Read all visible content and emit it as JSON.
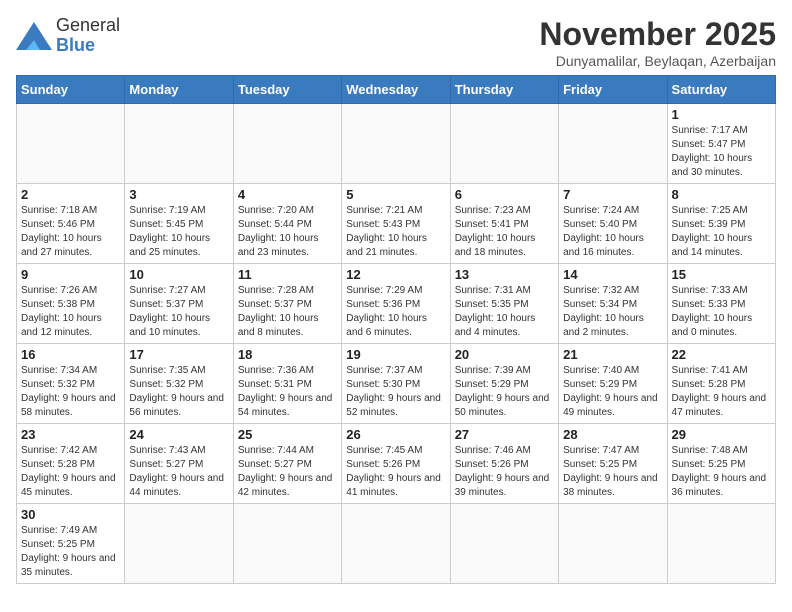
{
  "header": {
    "logo_line1": "General",
    "logo_line2": "Blue",
    "month_title": "November 2025",
    "location": "Dunyamalilar, Beylaqan, Azerbaijan"
  },
  "days_of_week": [
    "Sunday",
    "Monday",
    "Tuesday",
    "Wednesday",
    "Thursday",
    "Friday",
    "Saturday"
  ],
  "weeks": [
    [
      {
        "day": "",
        "info": ""
      },
      {
        "day": "",
        "info": ""
      },
      {
        "day": "",
        "info": ""
      },
      {
        "day": "",
        "info": ""
      },
      {
        "day": "",
        "info": ""
      },
      {
        "day": "",
        "info": ""
      },
      {
        "day": "1",
        "info": "Sunrise: 7:17 AM\nSunset: 5:47 PM\nDaylight: 10 hours and 30 minutes."
      }
    ],
    [
      {
        "day": "2",
        "info": "Sunrise: 7:18 AM\nSunset: 5:46 PM\nDaylight: 10 hours and 27 minutes."
      },
      {
        "day": "3",
        "info": "Sunrise: 7:19 AM\nSunset: 5:45 PM\nDaylight: 10 hours and 25 minutes."
      },
      {
        "day": "4",
        "info": "Sunrise: 7:20 AM\nSunset: 5:44 PM\nDaylight: 10 hours and 23 minutes."
      },
      {
        "day": "5",
        "info": "Sunrise: 7:21 AM\nSunset: 5:43 PM\nDaylight: 10 hours and 21 minutes."
      },
      {
        "day": "6",
        "info": "Sunrise: 7:23 AM\nSunset: 5:41 PM\nDaylight: 10 hours and 18 minutes."
      },
      {
        "day": "7",
        "info": "Sunrise: 7:24 AM\nSunset: 5:40 PM\nDaylight: 10 hours and 16 minutes."
      },
      {
        "day": "8",
        "info": "Sunrise: 7:25 AM\nSunset: 5:39 PM\nDaylight: 10 hours and 14 minutes."
      }
    ],
    [
      {
        "day": "9",
        "info": "Sunrise: 7:26 AM\nSunset: 5:38 PM\nDaylight: 10 hours and 12 minutes."
      },
      {
        "day": "10",
        "info": "Sunrise: 7:27 AM\nSunset: 5:37 PM\nDaylight: 10 hours and 10 minutes."
      },
      {
        "day": "11",
        "info": "Sunrise: 7:28 AM\nSunset: 5:37 PM\nDaylight: 10 hours and 8 minutes."
      },
      {
        "day": "12",
        "info": "Sunrise: 7:29 AM\nSunset: 5:36 PM\nDaylight: 10 hours and 6 minutes."
      },
      {
        "day": "13",
        "info": "Sunrise: 7:31 AM\nSunset: 5:35 PM\nDaylight: 10 hours and 4 minutes."
      },
      {
        "day": "14",
        "info": "Sunrise: 7:32 AM\nSunset: 5:34 PM\nDaylight: 10 hours and 2 minutes."
      },
      {
        "day": "15",
        "info": "Sunrise: 7:33 AM\nSunset: 5:33 PM\nDaylight: 10 hours and 0 minutes."
      }
    ],
    [
      {
        "day": "16",
        "info": "Sunrise: 7:34 AM\nSunset: 5:32 PM\nDaylight: 9 hours and 58 minutes."
      },
      {
        "day": "17",
        "info": "Sunrise: 7:35 AM\nSunset: 5:32 PM\nDaylight: 9 hours and 56 minutes."
      },
      {
        "day": "18",
        "info": "Sunrise: 7:36 AM\nSunset: 5:31 PM\nDaylight: 9 hours and 54 minutes."
      },
      {
        "day": "19",
        "info": "Sunrise: 7:37 AM\nSunset: 5:30 PM\nDaylight: 9 hours and 52 minutes."
      },
      {
        "day": "20",
        "info": "Sunrise: 7:39 AM\nSunset: 5:29 PM\nDaylight: 9 hours and 50 minutes."
      },
      {
        "day": "21",
        "info": "Sunrise: 7:40 AM\nSunset: 5:29 PM\nDaylight: 9 hours and 49 minutes."
      },
      {
        "day": "22",
        "info": "Sunrise: 7:41 AM\nSunset: 5:28 PM\nDaylight: 9 hours and 47 minutes."
      }
    ],
    [
      {
        "day": "23",
        "info": "Sunrise: 7:42 AM\nSunset: 5:28 PM\nDaylight: 9 hours and 45 minutes."
      },
      {
        "day": "24",
        "info": "Sunrise: 7:43 AM\nSunset: 5:27 PM\nDaylight: 9 hours and 44 minutes."
      },
      {
        "day": "25",
        "info": "Sunrise: 7:44 AM\nSunset: 5:27 PM\nDaylight: 9 hours and 42 minutes."
      },
      {
        "day": "26",
        "info": "Sunrise: 7:45 AM\nSunset: 5:26 PM\nDaylight: 9 hours and 41 minutes."
      },
      {
        "day": "27",
        "info": "Sunrise: 7:46 AM\nSunset: 5:26 PM\nDaylight: 9 hours and 39 minutes."
      },
      {
        "day": "28",
        "info": "Sunrise: 7:47 AM\nSunset: 5:25 PM\nDaylight: 9 hours and 38 minutes."
      },
      {
        "day": "29",
        "info": "Sunrise: 7:48 AM\nSunset: 5:25 PM\nDaylight: 9 hours and 36 minutes."
      }
    ],
    [
      {
        "day": "30",
        "info": "Sunrise: 7:49 AM\nSunset: 5:25 PM\nDaylight: 9 hours and 35 minutes."
      },
      {
        "day": "",
        "info": ""
      },
      {
        "day": "",
        "info": ""
      },
      {
        "day": "",
        "info": ""
      },
      {
        "day": "",
        "info": ""
      },
      {
        "day": "",
        "info": ""
      },
      {
        "day": "",
        "info": ""
      }
    ]
  ]
}
